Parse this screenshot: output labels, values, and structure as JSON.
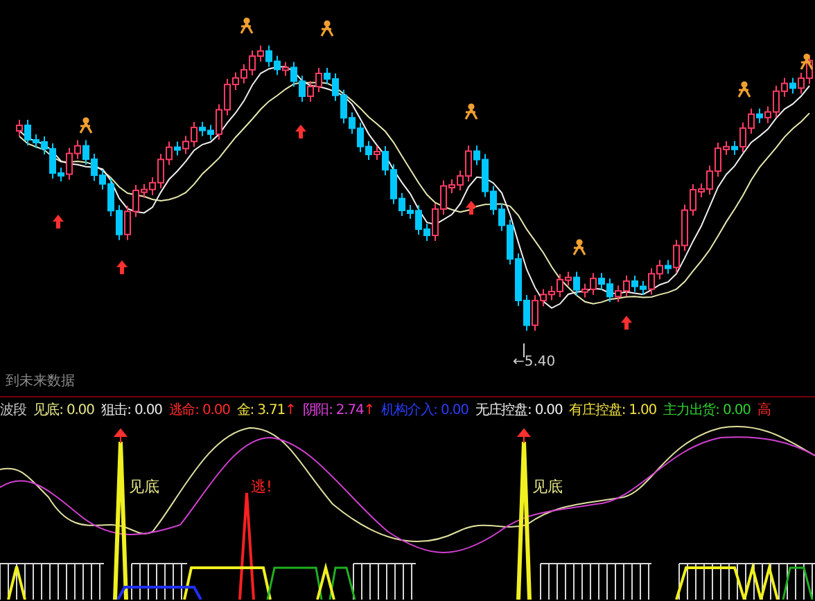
{
  "main_chart": {
    "low_label": "←5.40",
    "note": "到未来数据"
  },
  "indicator_labels": [
    {
      "text": "波段",
      "color": "#c8c8c8"
    },
    {
      "text": "见底: 0.00",
      "color": "#e6e68a"
    },
    {
      "text": "狙击: 0.00",
      "color": "#e8e8e8"
    },
    {
      "text": "逃命: 0.00",
      "color": "#ff2a2a"
    },
    {
      "text": "金: 3.71",
      "arrow": "↑",
      "color": "#f0e040"
    },
    {
      "text": "阴阳: 2.74",
      "arrow": "↑",
      "color": "#e040e0"
    },
    {
      "text": "机构介入: 0.00",
      "color": "#2a3cff"
    },
    {
      "text": "无庄控盘: 0.00",
      "color": "#f0f0f0"
    },
    {
      "text": "有庄控盘: 1.00",
      "color": "#f0e040"
    },
    {
      "text": "主力出货: 0.00",
      "color": "#30d030"
    },
    {
      "text": "高",
      "color": "#ff2a2a"
    }
  ],
  "chart_labels": [
    {
      "text": "见底",
      "color": "#e6e68a"
    },
    {
      "text": "逃!",
      "color": "#ff2020"
    },
    {
      "text": "见底",
      "color": "#e6e68a"
    }
  ]
}
